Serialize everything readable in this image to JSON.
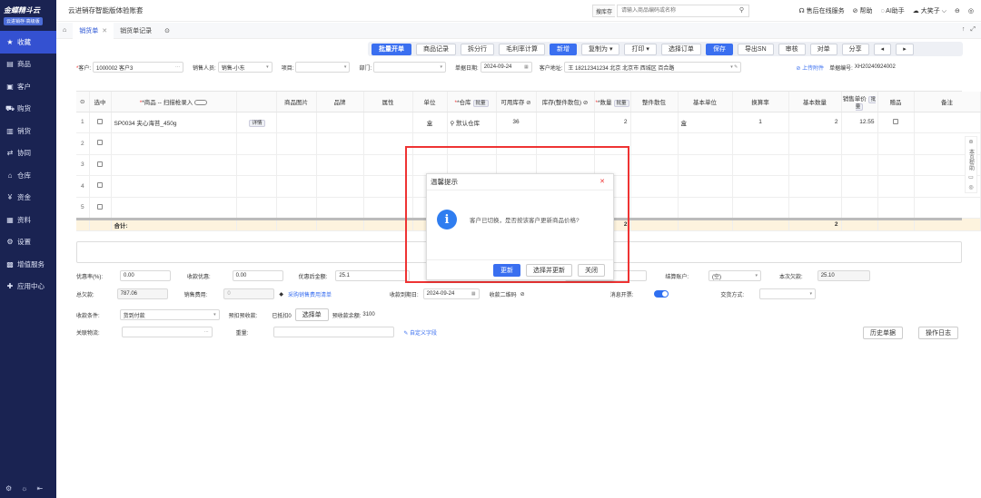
{
  "sidebar": {
    "logo": "金蝶精斗云",
    "logo_sub": "云进销存·高级版",
    "items": [
      {
        "icon": "★",
        "label": "收藏"
      },
      {
        "icon": "▤",
        "label": "商品"
      },
      {
        "icon": "▣",
        "label": "客户"
      },
      {
        "icon": "⛟",
        "label": "购货"
      },
      {
        "icon": "▥",
        "label": "销货"
      },
      {
        "icon": "⇄",
        "label": "协同"
      },
      {
        "icon": "⌂",
        "label": "仓库"
      },
      {
        "icon": "¥",
        "label": "资金"
      },
      {
        "icon": "▦",
        "label": "资料"
      },
      {
        "icon": "⚙",
        "label": "设置"
      },
      {
        "icon": "▩",
        "label": "增值服务"
      },
      {
        "icon": "✚",
        "label": "应用中心"
      }
    ]
  },
  "topbar": {
    "title": "云进销存智能版体验账套",
    "search_scope": "搜库存",
    "search_placeholder": "请输入商品编码或名称",
    "service": "售后在线服务",
    "help": "帮助",
    "ai": "AI助手",
    "user": "大笑子"
  },
  "tabs": [
    {
      "label": "销货单"
    },
    {
      "label": "销货单记录"
    }
  ],
  "toolbar": [
    "批量开单",
    "商品记录",
    "拆分行",
    "毛利率计算",
    "新增",
    "复制为 ▾",
    "打印 ▾",
    "选择订单",
    "保存",
    "导出SN",
    "审核",
    "对单",
    "分享"
  ],
  "form": {
    "customer_label": "客户:",
    "customer": "1000002 客户3",
    "seller_label": "销售人员:",
    "seller": "销售-小东",
    "project_label": "项目:",
    "dept_label": "部门:",
    "date_label": "单据日期:",
    "date": "2024-09-24",
    "addr_label": "客户地址:",
    "addr": "王 18212341234 北京 北京市 西城区 百合路",
    "attach": "上传附件",
    "no_label": "单据编号:",
    "no": "XH20240924002"
  },
  "table": {
    "headers": [
      "",
      "选中",
      "*商品 -- 扫描枪录入",
      "",
      "商品图片",
      "品牌",
      "属性",
      "单位",
      "*仓库",
      "可用库存",
      "库存(整件散包)",
      "*数量",
      "整件散包",
      "基本单位",
      "换算率",
      "基本数量",
      "销售单价",
      "赠品",
      "备注"
    ],
    "detail_btn": "详情",
    "batch": "批量",
    "rows": [
      {
        "no": "1",
        "product": "SP0034 夹心海苔_450g",
        "unit": "盒",
        "warehouse": "默认仓库",
        "stock": "36",
        "qty": "2",
        "base_unit": "盒",
        "rate": "1",
        "base_qty": "2",
        "price": "12.55"
      },
      {
        "no": "2"
      },
      {
        "no": "3"
      },
      {
        "no": "4"
      },
      {
        "no": "5"
      }
    ],
    "sum_label": "合计:",
    "sum_qty": "2",
    "sum_base": "2"
  },
  "bottom": {
    "disc_rate_label": "优惠率(%):",
    "disc_rate": "0.00",
    "disc_amt_label": "收款优惠:",
    "disc_amt": "0.00",
    "after_disc_label": "优惠后金额:",
    "after_disc": "25.1",
    "cust_label": "客户",
    "settle_label": "结算账户:",
    "settle": "(空)",
    "this_recv_label": "本次欠款:",
    "this_recv": "25.10",
    "total_due_label": "总欠款:",
    "total_due": "787.06",
    "sales_fee_label": "销售费用:",
    "sales_fee": "0",
    "purchase_link": "采购销售费用清单",
    "recv_date_label": "收款到期日:",
    "recv_date": "2024-09-24",
    "qr_label": "收款二维码",
    "msg_label": "消息开票:",
    "delivery_label": "交货方式:",
    "recv_cond_label": "收款条件:",
    "recv_cond": "货到付款",
    "prepay_label": "预扣预收款:",
    "used_label": "已抵扣0",
    "select_btn": "选择单",
    "balance_label": "预收款余额:",
    "balance": "3100",
    "logistics_label": "关联物流:",
    "weight_label": "重量:",
    "custom_link": "自定义字段",
    "history_btn": "历史单据",
    "log_btn": "操作日志"
  },
  "side_help": {
    "label": "本页帮助"
  },
  "dialog": {
    "title": "温馨提示",
    "message": "客户已切换，是否按该客户更新商品价格?",
    "update": "更新",
    "select_update": "选择并更新",
    "close": "关闭"
  }
}
